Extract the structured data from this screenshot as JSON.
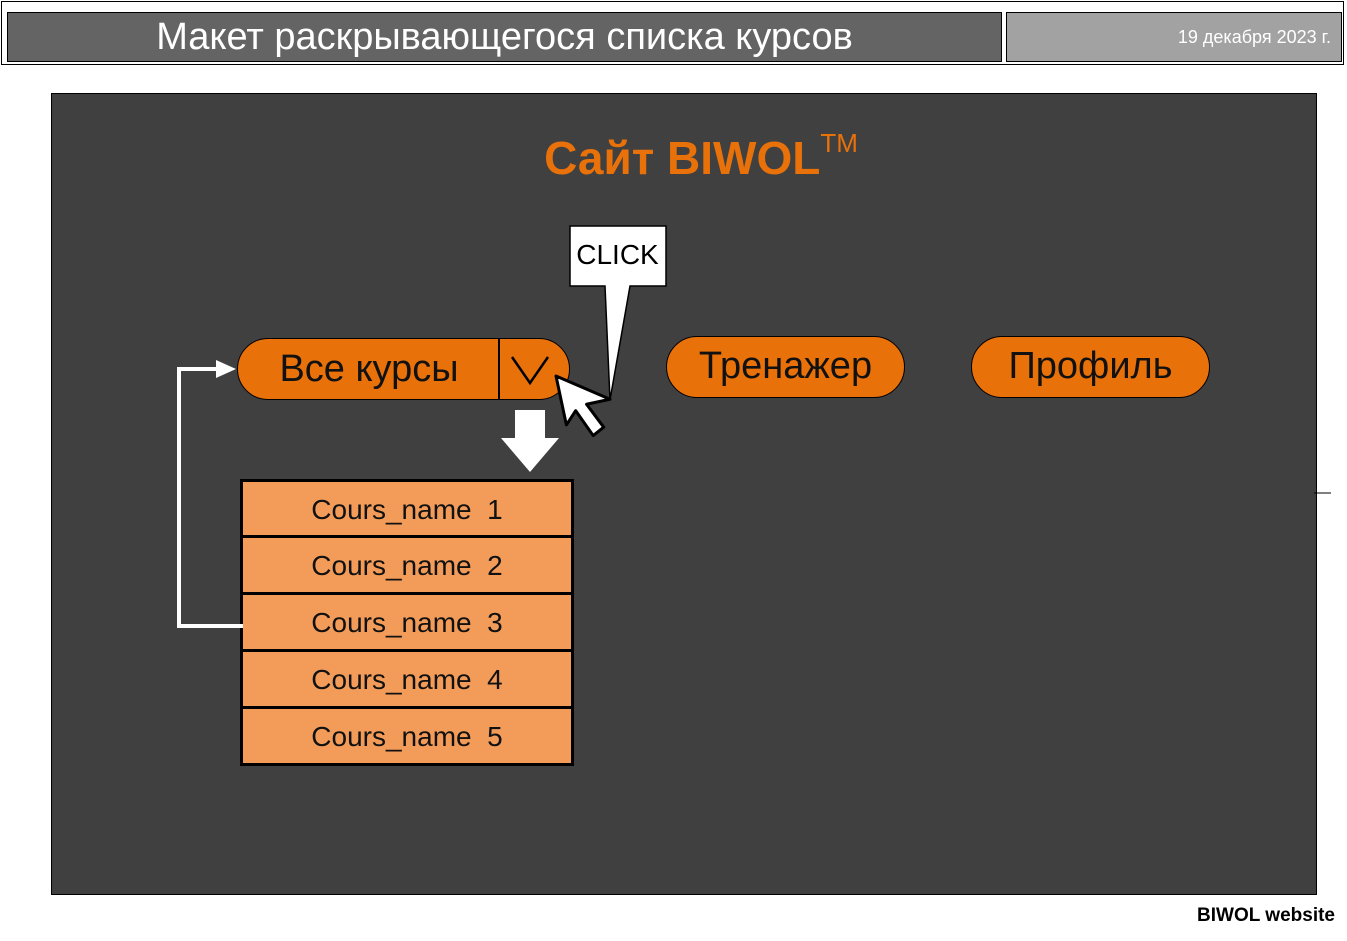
{
  "header": {
    "title": "Макет раскрывающегося списка курсов",
    "date": "19 декабря 2023 г."
  },
  "mockup": {
    "site_title": "Сайт BIWOL",
    "trademark": "TM",
    "nav": {
      "all_courses": "Все курсы",
      "trainer": "Тренажер",
      "profile": "Профиль"
    },
    "callout": "CLICK",
    "courses": [
      "Cours_name  1",
      "Cours_name  2",
      "Cours_name  3",
      "Cours_name  4",
      "Cours_name  5"
    ]
  },
  "footer": {
    "label": "BIWOL website"
  },
  "colors": {
    "accent": "#e8710a",
    "list_item": "#f39c5a",
    "canvas": "#404040",
    "title_bar": "#646464",
    "date_bar": "#a2a2a2"
  },
  "icons": [
    "chevron-down-icon",
    "down-arrow-icon",
    "cursor-icon",
    "return-arrow-icon"
  ]
}
